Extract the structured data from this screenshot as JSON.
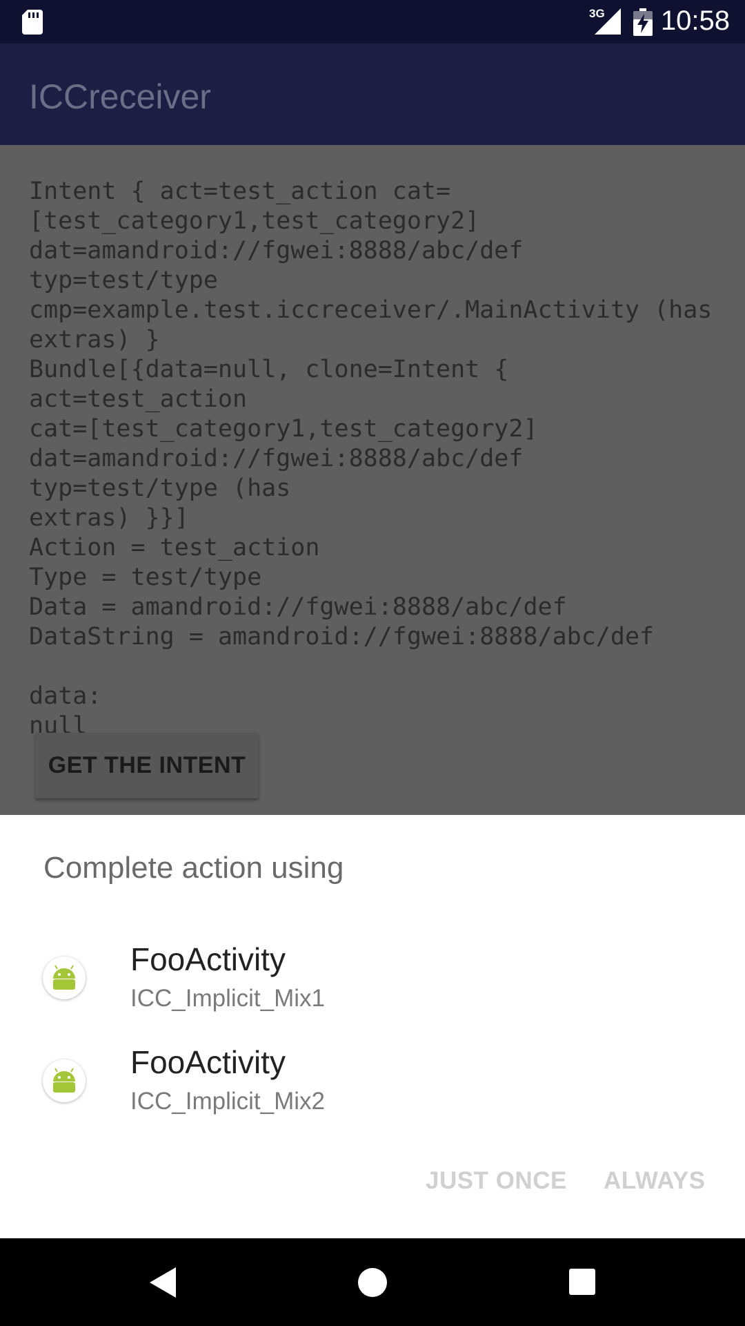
{
  "status_bar": {
    "network": "3G",
    "time": "10:58",
    "icons": [
      "sd-card-icon",
      "signal-icon",
      "battery-charging-icon"
    ]
  },
  "app_bar": {
    "title": "ICCreceiver"
  },
  "content": {
    "intent_text": "Intent { act=test_action cat=[test_category1,test_category2]\ndat=amandroid://fgwei:8888/abc/def typ=test/type\ncmp=example.test.iccreceiver/.MainActivity (has extras) }\nBundle[{data=null, clone=Intent { act=test_action\ncat=[test_category1,test_category2]\ndat=amandroid://fgwei:8888/abc/def typ=test/type (has\nextras) }}]\nAction = test_action\nType = test/type\nData = amandroid://fgwei:8888/abc/def\nDataString = amandroid://fgwei:8888/abc/def\n\ndata:\nnull",
    "button_label": "GET THE INTENT"
  },
  "chooser": {
    "title": "Complete action using",
    "items": [
      {
        "name": "FooActivity",
        "package": "ICC_Implicit_Mix1",
        "icon": "android-icon"
      },
      {
        "name": "FooActivity",
        "package": "ICC_Implicit_Mix2",
        "icon": "android-icon"
      }
    ],
    "just_once_label": "JUST ONCE",
    "always_label": "ALWAYS"
  },
  "nav_bar": {
    "icons": [
      "back-icon",
      "home-icon",
      "recents-icon"
    ]
  },
  "colors": {
    "status_bar": "#0e1230",
    "app_bar": "#1b1f44",
    "scrim_content": "#5f5f5f",
    "android_green": "#a4c639"
  }
}
